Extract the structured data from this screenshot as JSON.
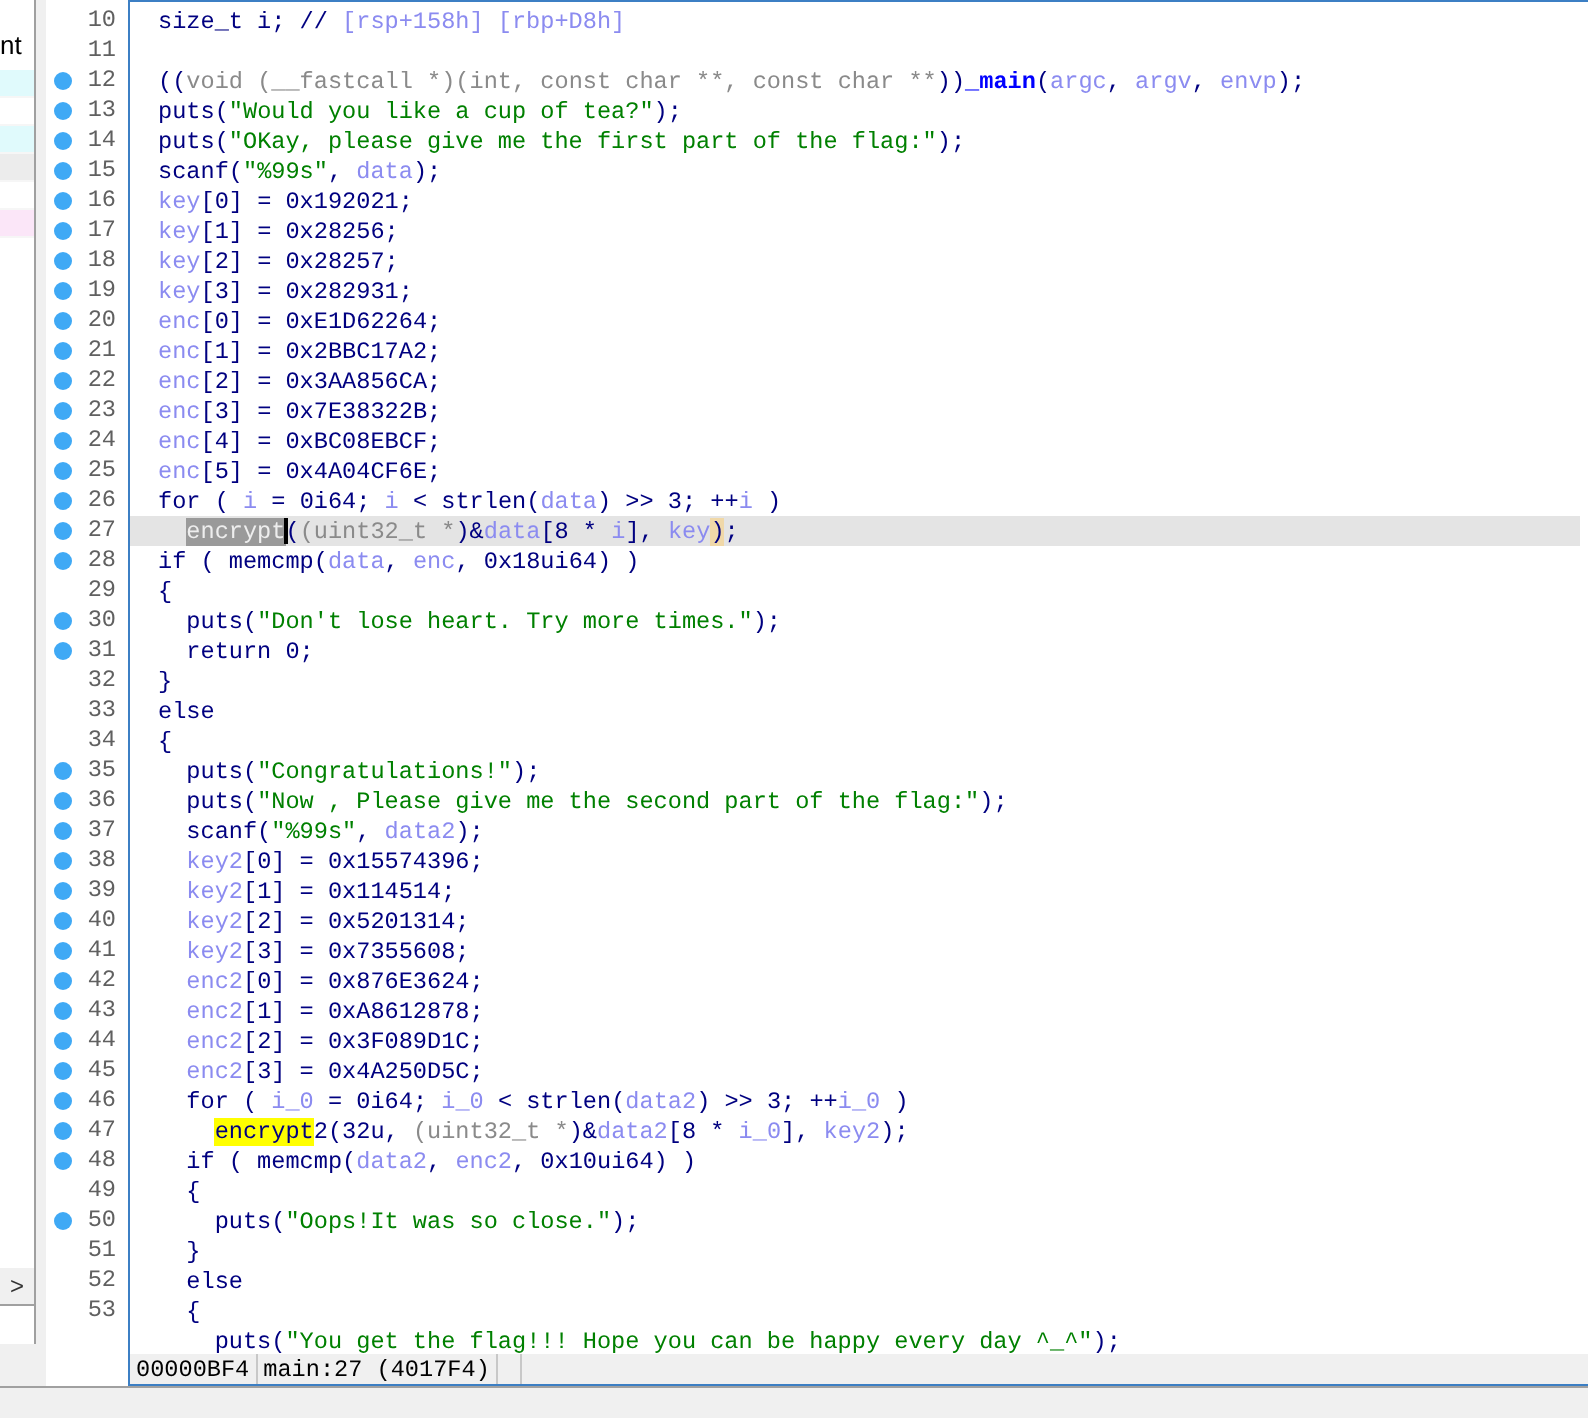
{
  "sidebar": {
    "label": "nt",
    "rows": [
      {
        "color": "#e0fafc"
      },
      {
        "color": "#ffffff"
      },
      {
        "color": "#e0fafc"
      },
      {
        "color": "#ececec"
      },
      {
        "color": "#ffffff"
      },
      {
        "color": "#fbe6f8"
      }
    ],
    "expand_button": ">"
  },
  "code_lines": [
    {
      "number": "10",
      "breakpoint": false,
      "current": false,
      "tokens": [
        {
          "kind": "plain",
          "text": "size_t i; // "
        },
        {
          "kind": "var",
          "text": "[rsp+158h] [rbp+D8h]"
        }
      ]
    },
    {
      "number": "11",
      "breakpoint": false,
      "current": false
    },
    {
      "number": "12",
      "breakpoint": true,
      "current": false,
      "tokens": [
        {
          "kind": "plain",
          "text": "(("
        },
        {
          "kind": "cast",
          "text": "void (__fastcall *)(int, const char **, const char **"
        },
        {
          "kind": "plain",
          "text": "))"
        },
        {
          "kind": "name",
          "text": "_main"
        },
        {
          "kind": "plain",
          "text": "("
        },
        {
          "kind": "var",
          "text": "argc"
        },
        {
          "kind": "plain",
          "text": ", "
        },
        {
          "kind": "var",
          "text": "argv"
        },
        {
          "kind": "plain",
          "text": ", "
        },
        {
          "kind": "var",
          "text": "envp"
        },
        {
          "kind": "plain",
          "text": ");"
        }
      ]
    },
    {
      "number": "13",
      "breakpoint": true,
      "current": false,
      "tokens": [
        {
          "kind": "plain",
          "text": "puts("
        },
        {
          "kind": "string",
          "text": "\"Would you like a cup of tea?\""
        },
        {
          "kind": "plain",
          "text": ");"
        }
      ]
    },
    {
      "number": "14",
      "breakpoint": true,
      "current": false,
      "tokens": [
        {
          "kind": "plain",
          "text": "puts("
        },
        {
          "kind": "string",
          "text": "\"OKay, please give me the first part of the flag:\""
        },
        {
          "kind": "plain",
          "text": ");"
        }
      ]
    },
    {
      "number": "15",
      "breakpoint": true,
      "current": false,
      "tokens": [
        {
          "kind": "plain",
          "text": "scanf("
        },
        {
          "kind": "string",
          "text": "\"%99s\""
        },
        {
          "kind": "plain",
          "text": ", "
        },
        {
          "kind": "var",
          "text": "data"
        },
        {
          "kind": "plain",
          "text": ");"
        }
      ]
    },
    {
      "number": "16",
      "breakpoint": true,
      "current": false,
      "tokens": [
        {
          "kind": "var",
          "text": "key"
        },
        {
          "kind": "plain",
          "text": "[0] = 0x192021;"
        }
      ]
    },
    {
      "number": "17",
      "breakpoint": true,
      "current": false,
      "tokens": [
        {
          "kind": "var",
          "text": "key"
        },
        {
          "kind": "plain",
          "text": "[1] = 0x28256;"
        }
      ]
    },
    {
      "number": "18",
      "breakpoint": true,
      "current": false,
      "tokens": [
        {
          "kind": "var",
          "text": "key"
        },
        {
          "kind": "plain",
          "text": "[2] = 0x28257;"
        }
      ]
    },
    {
      "number": "19",
      "breakpoint": true,
      "current": false,
      "tokens": [
        {
          "kind": "var",
          "text": "key"
        },
        {
          "kind": "plain",
          "text": "[3] = 0x282931;"
        }
      ]
    },
    {
      "number": "20",
      "breakpoint": true,
      "current": false,
      "tokens": [
        {
          "kind": "var",
          "text": "enc"
        },
        {
          "kind": "plain",
          "text": "[0] = 0xE1D62264;"
        }
      ]
    },
    {
      "number": "21",
      "breakpoint": true,
      "current": false,
      "tokens": [
        {
          "kind": "var",
          "text": "enc"
        },
        {
          "kind": "plain",
          "text": "[1] = 0x2BBC17A2;"
        }
      ]
    },
    {
      "number": "22",
      "breakpoint": true,
      "current": false,
      "tokens": [
        {
          "kind": "var",
          "text": "enc"
        },
        {
          "kind": "plain",
          "text": "[2] = 0x3AA856CA;"
        }
      ]
    },
    {
      "number": "23",
      "breakpoint": true,
      "current": false,
      "tokens": [
        {
          "kind": "var",
          "text": "enc"
        },
        {
          "kind": "plain",
          "text": "[3] = 0x7E38322B;"
        }
      ]
    },
    {
      "number": "24",
      "breakpoint": true,
      "current": false,
      "tokens": [
        {
          "kind": "var",
          "text": "enc"
        },
        {
          "kind": "plain",
          "text": "[4] = 0xBC08EBCF;"
        }
      ]
    },
    {
      "number": "25",
      "breakpoint": true,
      "current": false,
      "tokens": [
        {
          "kind": "var",
          "text": "enc"
        },
        {
          "kind": "plain",
          "text": "[5] = 0x4A04CF6E;"
        }
      ]
    },
    {
      "number": "26",
      "breakpoint": true,
      "current": false,
      "tokens": [
        {
          "kind": "plain",
          "text": "for ( "
        },
        {
          "kind": "var",
          "text": "i"
        },
        {
          "kind": "plain",
          "text": " = 0i64; "
        },
        {
          "kind": "var",
          "text": "i"
        },
        {
          "kind": "plain",
          "text": " < strlen("
        },
        {
          "kind": "var",
          "text": "data"
        },
        {
          "kind": "plain",
          "text": ") >> 3; ++"
        },
        {
          "kind": "var",
          "text": "i"
        },
        {
          "kind": "plain",
          "text": " )"
        }
      ],
      "children": [
        {
          "number": "27",
          "breakpoint": true,
          "current": true,
          "tokens": [
            {
              "kind": "selected",
              "text": "encrypt"
            },
            {
              "kind": "plain",
              "text": "("
            },
            {
              "kind": "cast",
              "text": "(uint32_t *"
            },
            {
              "kind": "plain",
              "text": ")&"
            },
            {
              "kind": "var",
              "text": "data"
            },
            {
              "kind": "plain",
              "text": "[8 * "
            },
            {
              "kind": "var",
              "text": "i"
            },
            {
              "kind": "plain",
              "text": "], "
            },
            {
              "kind": "var",
              "text": "key"
            },
            {
              "kind": "match",
              "text": ")"
            },
            {
              "kind": "plain",
              "text": ";"
            }
          ]
        }
      ]
    },
    {
      "number": "28",
      "breakpoint": true,
      "current": false,
      "tokens": [
        {
          "kind": "plain",
          "text": "if ( memcmp("
        },
        {
          "kind": "var",
          "text": "data"
        },
        {
          "kind": "plain",
          "text": ", "
        },
        {
          "kind": "var",
          "text": "enc"
        },
        {
          "kind": "plain",
          "text": ", 0x18ui64) )"
        }
      ]
    },
    {
      "number": "29",
      "breakpoint": false,
      "current": false,
      "tokens": [
        {
          "kind": "plain",
          "text": "{"
        }
      ],
      "children": [
        {
          "number": "30",
          "breakpoint": true,
          "current": false,
          "tokens": [
            {
              "kind": "plain",
              "text": "puts("
            },
            {
              "kind": "string",
              "text": "\"Don't lose heart. Try more times.\""
            },
            {
              "kind": "plain",
              "text": ");"
            }
          ]
        },
        {
          "number": "31",
          "breakpoint": true,
          "current": false,
          "tokens": [
            {
              "kind": "plain",
              "text": "return 0;"
            }
          ]
        }
      ]
    },
    {
      "number": "32",
      "breakpoint": false,
      "current": false,
      "tokens": [
        {
          "kind": "plain",
          "text": "}"
        }
      ]
    },
    {
      "number": "33",
      "breakpoint": false,
      "current": false,
      "tokens": [
        {
          "kind": "plain",
          "text": "else"
        }
      ]
    },
    {
      "number": "34",
      "breakpoint": false,
      "current": false,
      "tokens": [
        {
          "kind": "plain",
          "text": "{"
        }
      ],
      "children": [
        {
          "number": "35",
          "breakpoint": true,
          "current": false,
          "tokens": [
            {
              "kind": "plain",
              "text": "puts("
            },
            {
              "kind": "string",
              "text": "\"Congratulations!\""
            },
            {
              "kind": "plain",
              "text": ");"
            }
          ]
        },
        {
          "number": "36",
          "breakpoint": true,
          "current": false,
          "tokens": [
            {
              "kind": "plain",
              "text": "puts("
            },
            {
              "kind": "string",
              "text": "\"Now , Please give me the second part of the flag:\""
            },
            {
              "kind": "plain",
              "text": ");"
            }
          ]
        },
        {
          "number": "37",
          "breakpoint": true,
          "current": false,
          "tokens": [
            {
              "kind": "plain",
              "text": "scanf("
            },
            {
              "kind": "string",
              "text": "\"%99s\""
            },
            {
              "kind": "plain",
              "text": ", "
            },
            {
              "kind": "var",
              "text": "data2"
            },
            {
              "kind": "plain",
              "text": ");"
            }
          ]
        },
        {
          "number": "38",
          "breakpoint": true,
          "current": false,
          "tokens": [
            {
              "kind": "var",
              "text": "key2"
            },
            {
              "kind": "plain",
              "text": "[0] = 0x15574396;"
            }
          ]
        },
        {
          "number": "39",
          "breakpoint": true,
          "current": false,
          "tokens": [
            {
              "kind": "var",
              "text": "key2"
            },
            {
              "kind": "plain",
              "text": "[1] = 0x114514;"
            }
          ]
        },
        {
          "number": "40",
          "breakpoint": true,
          "current": false,
          "tokens": [
            {
              "kind": "var",
              "text": "key2"
            },
            {
              "kind": "plain",
              "text": "[2] = 0x5201314;"
            }
          ]
        },
        {
          "number": "41",
          "breakpoint": true,
          "current": false,
          "tokens": [
            {
              "kind": "var",
              "text": "key2"
            },
            {
              "kind": "plain",
              "text": "[3] = 0x7355608;"
            }
          ]
        },
        {
          "number": "42",
          "breakpoint": true,
          "current": false,
          "tokens": [
            {
              "kind": "var",
              "text": "enc2"
            },
            {
              "kind": "plain",
              "text": "[0] = 0x876E3624;"
            }
          ]
        },
        {
          "number": "43",
          "breakpoint": true,
          "current": false,
          "tokens": [
            {
              "kind": "var",
              "text": "enc2"
            },
            {
              "kind": "plain",
              "text": "[1] = 0xA8612878;"
            }
          ]
        },
        {
          "number": "44",
          "breakpoint": true,
          "current": false,
          "tokens": [
            {
              "kind": "var",
              "text": "enc2"
            },
            {
              "kind": "plain",
              "text": "[2] = 0x3F089D1C;"
            }
          ]
        },
        {
          "number": "45",
          "breakpoint": true,
          "current": false,
          "tokens": [
            {
              "kind": "var",
              "text": "enc2"
            },
            {
              "kind": "plain",
              "text": "[3] = 0x4A250D5C;"
            }
          ]
        },
        {
          "number": "46",
          "breakpoint": true,
          "current": false,
          "tokens": [
            {
              "kind": "plain",
              "text": "for ( "
            },
            {
              "kind": "var",
              "text": "i_0"
            },
            {
              "kind": "plain",
              "text": " = 0i64; "
            },
            {
              "kind": "var",
              "text": "i_0"
            },
            {
              "kind": "plain",
              "text": " < strlen("
            },
            {
              "kind": "var",
              "text": "data2"
            },
            {
              "kind": "plain",
              "text": ") >> 3; ++"
            },
            {
              "kind": "var",
              "text": "i_0"
            },
            {
              "kind": "plain",
              "text": " )"
            }
          ],
          "children": [
            {
              "number": "47",
              "breakpoint": true,
              "current": false,
              "tokens": [
                {
                  "kind": "highlight",
                  "text": "encrypt"
                },
                {
                  "kind": "plain",
                  "text": "2(32u, "
                },
                {
                  "kind": "cast",
                  "text": "(uint32_t *"
                },
                {
                  "kind": "plain",
                  "text": ")&"
                },
                {
                  "kind": "var",
                  "text": "data2"
                },
                {
                  "kind": "plain",
                  "text": "[8 * "
                },
                {
                  "kind": "var",
                  "text": "i_0"
                },
                {
                  "kind": "plain",
                  "text": "], "
                },
                {
                  "kind": "var",
                  "text": "key2"
                },
                {
                  "kind": "plain",
                  "text": ");"
                }
              ]
            }
          ]
        },
        {
          "number": "48",
          "breakpoint": true,
          "current": false,
          "tokens": [
            {
              "kind": "plain",
              "text": "if ( memcmp("
            },
            {
              "kind": "var",
              "text": "data2"
            },
            {
              "kind": "plain",
              "text": ", "
            },
            {
              "kind": "var",
              "text": "enc2"
            },
            {
              "kind": "plain",
              "text": ", 0x10ui64) )"
            }
          ]
        },
        {
          "number": "49",
          "breakpoint": false,
          "current": false,
          "tokens": [
            {
              "kind": "plain",
              "text": "{"
            }
          ],
          "children": [
            {
              "number": "50",
              "breakpoint": true,
              "current": false,
              "tokens": [
                {
                  "kind": "plain",
                  "text": "puts("
                },
                {
                  "kind": "string",
                  "text": "\"Oops!It was so close.\""
                },
                {
                  "kind": "plain",
                  "text": ");"
                }
              ]
            }
          ]
        },
        {
          "number": "51",
          "breakpoint": false,
          "current": false,
          "tokens": [
            {
              "kind": "plain",
              "text": "}"
            }
          ]
        },
        {
          "number": "52",
          "breakpoint": false,
          "current": false,
          "tokens": [
            {
              "kind": "plain",
              "text": "else"
            }
          ]
        },
        {
          "number": "53",
          "breakpoint": false,
          "current": false,
          "tokens": [
            {
              "kind": "plain",
              "text": "{"
            }
          ],
          "children": [
            {
              "breakpoint": false,
              "current": false,
              "tokens": [
                {
                  "kind": "plain",
                  "text": "puts("
                },
                {
                  "kind": "string",
                  "text": "\"You get the flag!!! Hope you can be happy every day ^_^\""
                },
                {
                  "kind": "plain",
                  "text": ");"
                }
              ]
            }
          ]
        }
      ]
    }
  ],
  "status_bar": [
    "00000BF4",
    "main:27 (4017F4)"
  ]
}
